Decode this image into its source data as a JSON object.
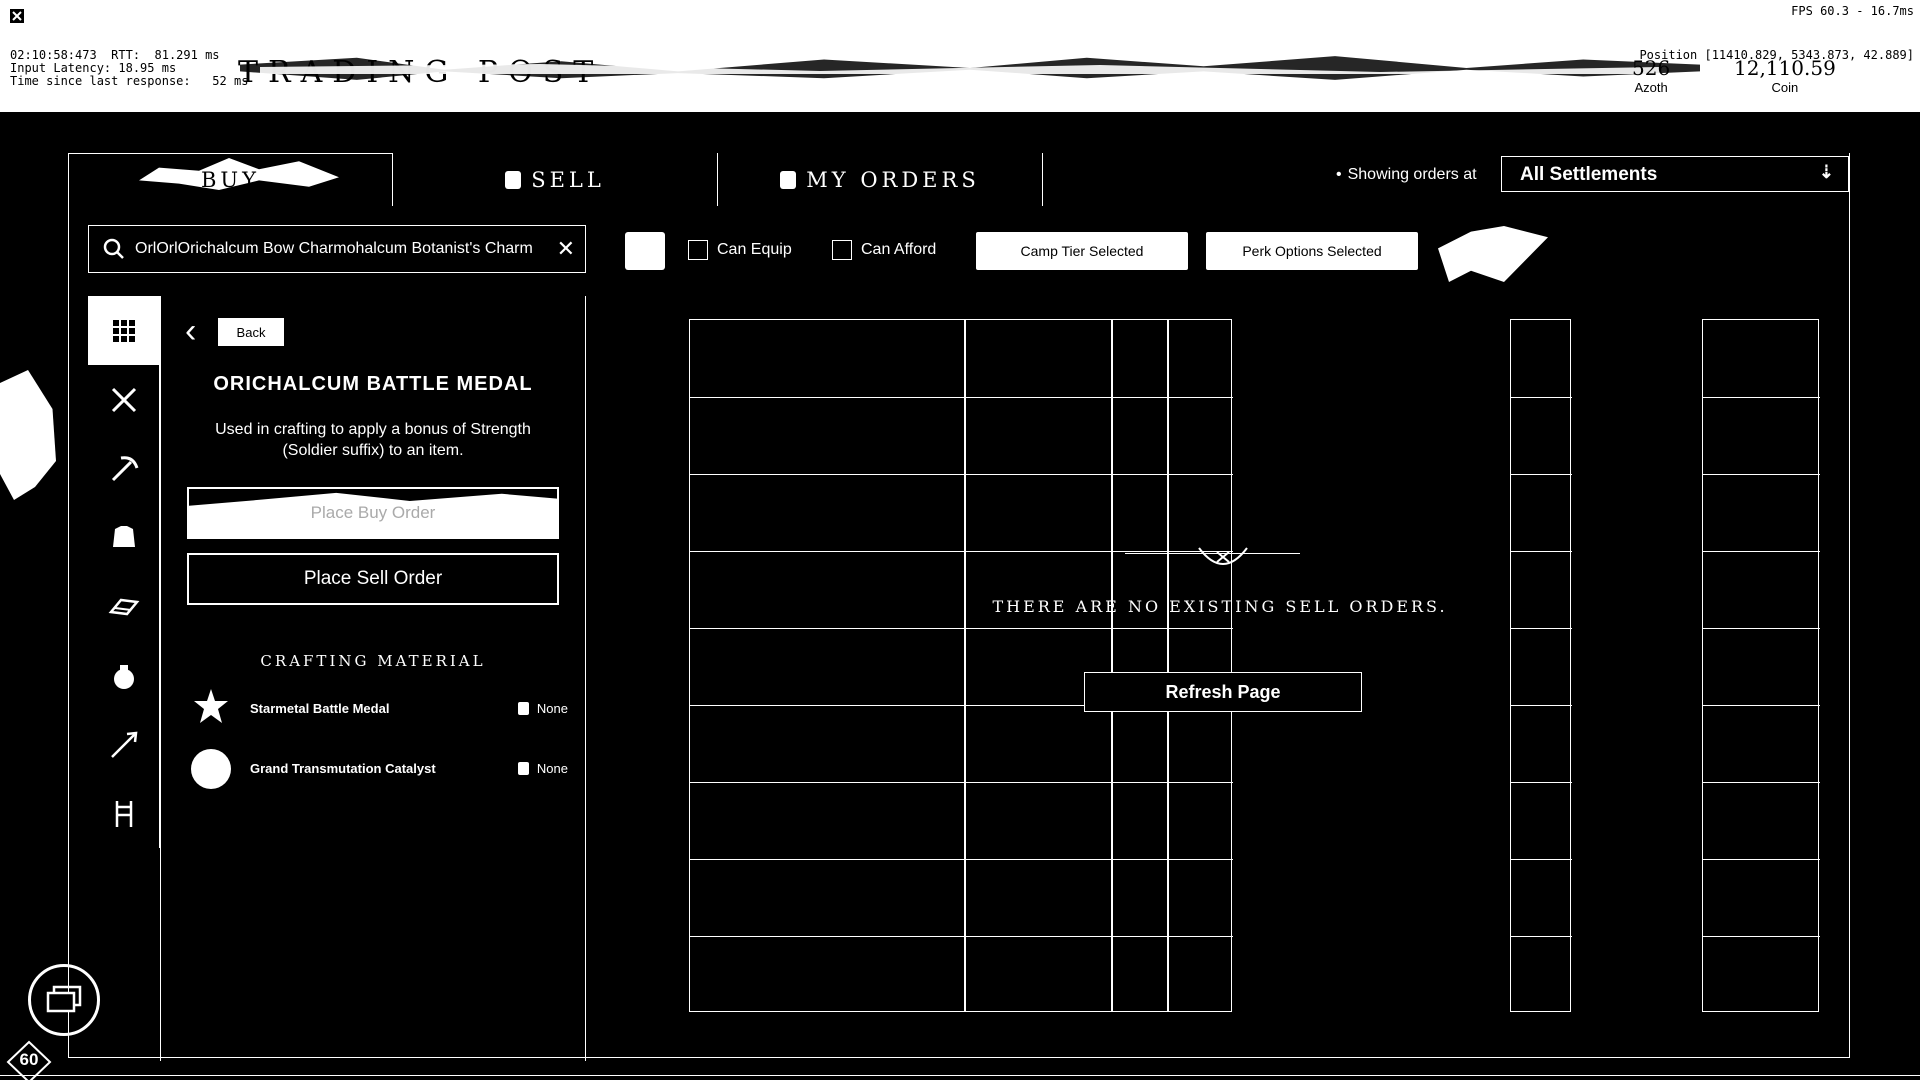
{
  "debug": {
    "line1": "02:10:58:473  RTT:  81.291 ms",
    "line2": "Input Latency: 18.95 ms",
    "line3": "Time since last response:   52 ms",
    "fps": "FPS 60.3 - 16.7ms",
    "position": "Position [11410.829, 5343.873, 42.889]"
  },
  "header": {
    "title": "TRADING POST",
    "azoth_value": "526",
    "azoth_label": "Azoth",
    "coin_value": "12,110.59",
    "coin_label": "Coin"
  },
  "tabs": {
    "buy": "BUY",
    "sell": "SELL",
    "orders": "MY ORDERS"
  },
  "location": {
    "label": "Showing orders at",
    "selected": "All Settlements"
  },
  "search": {
    "value": "OrlOrlOrichalcum Bow Charmohalcum Botanist's Charm"
  },
  "filters": {
    "can_equip": "Can Equip",
    "can_afford": "Can Afford",
    "camp": "Camp Tier Selected",
    "perks": "Perk Options Selected"
  },
  "categories": [
    "all-items",
    "weapons",
    "tools",
    "armor",
    "resources",
    "consumables",
    "ammunition",
    "furniture"
  ],
  "item": {
    "back_label": "Back",
    "name": "ORICHALCUM BATTLE MEDAL",
    "description": "Used in crafting to apply a bonus of Strength (Soldier suffix) to an item.",
    "buy_button": "Place Buy Order",
    "sell_button": "Place Sell Order",
    "section_title": "CRAFTING MATERIAL",
    "materials": [
      {
        "name": "Starmetal Battle Medal",
        "owned": "None"
      },
      {
        "name": "Grand Transmutation Catalyst",
        "owned": "None"
      }
    ]
  },
  "orders": {
    "empty_message": "THERE ARE NO EXISTING SELL ORDERS.",
    "refresh_button": "Refresh Page"
  },
  "hud": {
    "level": "60"
  }
}
